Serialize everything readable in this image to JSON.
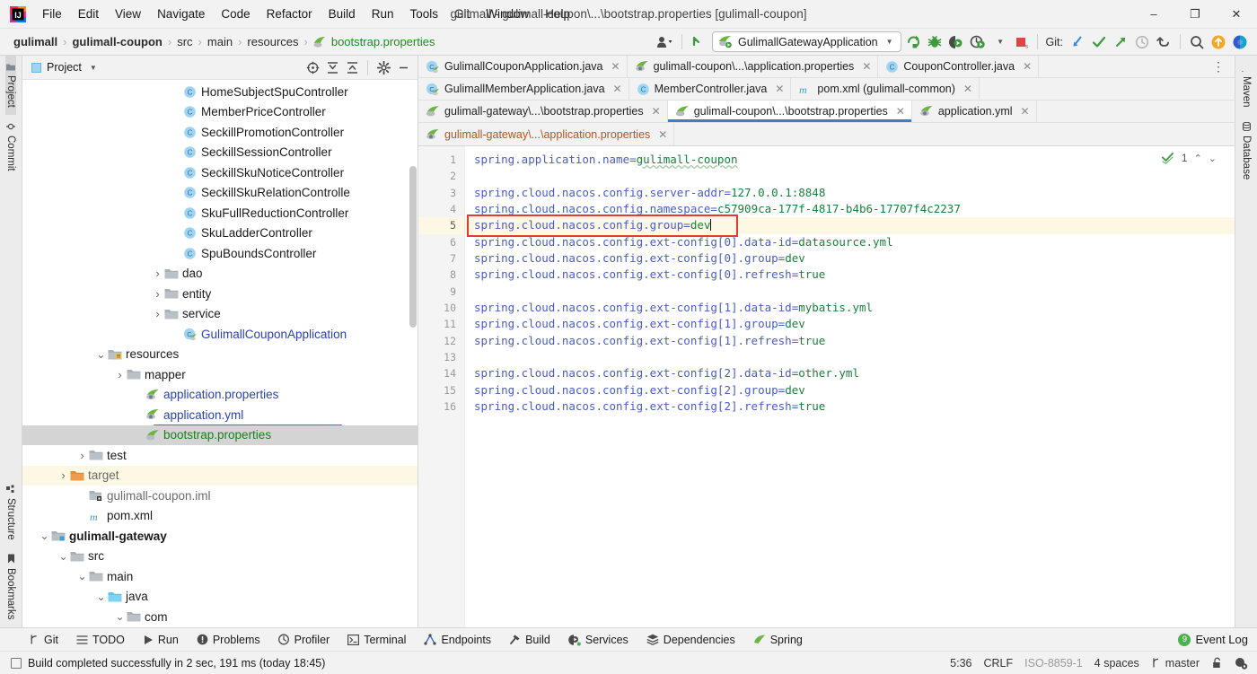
{
  "window": {
    "title": "gulimall - gulimall-coupon\\...\\bootstrap.properties [gulimall-coupon]",
    "minimize": "–",
    "maximize": "❐",
    "close": "✕"
  },
  "menubar": {
    "items": [
      "File",
      "Edit",
      "View",
      "Navigate",
      "Code",
      "Refactor",
      "Build",
      "Run",
      "Tools",
      "Git",
      "Window",
      "Help"
    ]
  },
  "navbar": {
    "crumbs": [
      {
        "label": "gulimall",
        "style": "bold"
      },
      {
        "label": "gulimall-coupon",
        "style": "bold"
      },
      {
        "label": "src",
        "style": "normal"
      },
      {
        "label": "main",
        "style": "normal"
      },
      {
        "label": "resources",
        "style": "normal"
      },
      {
        "label": "bootstrap.properties",
        "style": "file"
      }
    ],
    "separator": "›",
    "run_config": "GulimallGatewayApplication",
    "git_label": "Git:"
  },
  "left_rail": {
    "items": [
      "Project",
      "Commit",
      "Structure",
      "Bookmarks"
    ]
  },
  "right_rail": {
    "items": [
      "Maven",
      "Database"
    ]
  },
  "project_panel": {
    "title": "Project",
    "tree": [
      {
        "label": "HomeSubjectSpuController",
        "icon": "class-icon",
        "indent": 7,
        "arrow": "none",
        "color": "plain"
      },
      {
        "label": "MemberPriceController",
        "icon": "class-icon",
        "indent": 7,
        "arrow": "none",
        "color": "plain"
      },
      {
        "label": "SeckillPromotionController",
        "icon": "class-icon",
        "indent": 7,
        "arrow": "none",
        "color": "plain"
      },
      {
        "label": "SeckillSessionController",
        "icon": "class-icon",
        "indent": 7,
        "arrow": "none",
        "color": "plain"
      },
      {
        "label": "SeckillSkuNoticeController",
        "icon": "class-icon",
        "indent": 7,
        "arrow": "none",
        "color": "plain"
      },
      {
        "label": "SeckillSkuRelationControlle",
        "icon": "class-icon",
        "indent": 7,
        "arrow": "none",
        "color": "plain"
      },
      {
        "label": "SkuFullReductionController",
        "icon": "class-icon",
        "indent": 7,
        "arrow": "none",
        "color": "plain"
      },
      {
        "label": "SkuLadderController",
        "icon": "class-icon",
        "indent": 7,
        "arrow": "none",
        "color": "plain"
      },
      {
        "label": "SpuBoundsController",
        "icon": "class-icon",
        "indent": 7,
        "arrow": "none",
        "color": "plain"
      },
      {
        "label": "dao",
        "icon": "folder-icon",
        "indent": 6,
        "arrow": "collapsed",
        "color": "plain"
      },
      {
        "label": "entity",
        "icon": "folder-icon",
        "indent": 6,
        "arrow": "collapsed",
        "color": "plain"
      },
      {
        "label": "service",
        "icon": "folder-icon",
        "indent": 6,
        "arrow": "collapsed",
        "color": "plain"
      },
      {
        "label": "GulimallCouponApplication",
        "icon": "spring-class-icon",
        "indent": 7,
        "arrow": "none",
        "color": "blue"
      },
      {
        "label": "resources",
        "icon": "resources-folder-icon",
        "indent": 3,
        "arrow": "expanded",
        "color": "plain"
      },
      {
        "label": "mapper",
        "icon": "folder-icon",
        "indent": 4,
        "arrow": "collapsed",
        "color": "plain"
      },
      {
        "label": "application.properties",
        "icon": "spring-properties-icon",
        "indent": 5,
        "arrow": "none",
        "color": "blue"
      },
      {
        "label": "application.yml",
        "icon": "spring-properties-icon",
        "indent": 5,
        "arrow": "none",
        "color": "blue"
      },
      {
        "label": "bootstrap.properties",
        "icon": "spring-bootstrap-icon",
        "indent": 5,
        "arrow": "none",
        "color": "green",
        "selected": true,
        "highlighted": true
      },
      {
        "label": "test",
        "icon": "folder-icon",
        "indent": 2,
        "arrow": "collapsed",
        "color": "plain"
      },
      {
        "label": "target",
        "icon": "target-folder-icon",
        "indent": 1,
        "arrow": "collapsed",
        "color": "gray",
        "rowhl": true
      },
      {
        "label": "gulimall-coupon.iml",
        "icon": "iml-icon",
        "indent": 2,
        "arrow": "none",
        "color": "gray"
      },
      {
        "label": "pom.xml",
        "icon": "maven-icon",
        "indent": 2,
        "arrow": "none",
        "color": "plain"
      },
      {
        "label": "gulimall-gateway",
        "icon": "module-icon",
        "indent": 0,
        "arrow": "expanded",
        "color": "bold"
      },
      {
        "label": "src",
        "icon": "folder-icon",
        "indent": 1,
        "arrow": "expanded",
        "color": "plain"
      },
      {
        "label": "main",
        "icon": "folder-icon",
        "indent": 2,
        "arrow": "expanded",
        "color": "plain"
      },
      {
        "label": "java",
        "icon": "source-folder-icon",
        "indent": 3,
        "arrow": "expanded",
        "color": "plain"
      },
      {
        "label": "com",
        "icon": "folder-icon",
        "indent": 4,
        "arrow": "expanded",
        "color": "plain"
      }
    ]
  },
  "editor": {
    "tab_rows": [
      [
        {
          "label": "GulimallCouponApplication.java",
          "icon": "spring-class-icon",
          "active": false,
          "color": "plain"
        },
        {
          "label": "gulimall-coupon\\...\\application.properties",
          "icon": "spring-properties-icon",
          "active": false,
          "color": "plain"
        },
        {
          "label": "CouponController.java",
          "icon": "class-icon",
          "active": false,
          "color": "plain"
        }
      ],
      [
        {
          "label": "GulimallMemberApplication.java",
          "icon": "spring-class-icon",
          "active": false,
          "color": "plain"
        },
        {
          "label": "MemberController.java",
          "icon": "class-icon",
          "active": false,
          "color": "plain"
        },
        {
          "label": "pom.xml (gulimall-common)",
          "icon": "maven-icon",
          "active": false,
          "color": "plain"
        }
      ],
      [
        {
          "label": "gulimall-gateway\\...\\bootstrap.properties",
          "icon": "spring-bootstrap-icon",
          "active": false,
          "color": "plain"
        },
        {
          "label": "gulimall-coupon\\...\\bootstrap.properties",
          "icon": "spring-bootstrap-icon",
          "active": true,
          "color": "plain"
        },
        {
          "label": "application.yml",
          "icon": "spring-properties-icon",
          "active": false,
          "color": "plain"
        }
      ],
      [
        {
          "label": "gulimall-gateway\\...\\application.properties",
          "icon": "spring-properties-icon",
          "active": false,
          "color": "orange"
        }
      ]
    ],
    "close_glyph": "✕",
    "inspection_count": "1",
    "lines": [
      {
        "n": "1",
        "segs": [
          {
            "t": "spring.application.name=",
            "c": "k"
          },
          {
            "t": "gulimall-coupon",
            "c": "vu"
          }
        ]
      },
      {
        "n": "2",
        "segs": []
      },
      {
        "n": "3",
        "segs": [
          {
            "t": "spring.cloud.nacos.config.server-addr=",
            "c": "k"
          },
          {
            "t": "127.0.0.1:8848",
            "c": "v"
          }
        ]
      },
      {
        "n": "4",
        "segs": [
          {
            "t": "spring.cloud.nacos.config.namespace=",
            "c": "k"
          },
          {
            "t": "c57909ca-177f-4817-b4b6-17707f4c2237",
            "c": "v"
          }
        ]
      },
      {
        "n": "5",
        "segs": [
          {
            "t": "spring.cloud.nacos.config.group=",
            "c": "k"
          },
          {
            "t": "dev",
            "c": "v"
          }
        ],
        "current": true,
        "caret": true
      },
      {
        "n": "6",
        "segs": [
          {
            "t": "spring.cloud.nacos.config.ext-config[0].data-id=",
            "c": "k"
          },
          {
            "t": "datasource.yml",
            "c": "v"
          }
        ]
      },
      {
        "n": "7",
        "segs": [
          {
            "t": "spring.cloud.nacos.config.ext-config[0].group=",
            "c": "k"
          },
          {
            "t": "dev",
            "c": "v"
          }
        ]
      },
      {
        "n": "8",
        "segs": [
          {
            "t": "spring.cloud.nacos.config.ext-config[0].refresh=",
            "c": "k"
          },
          {
            "t": "true",
            "c": "v"
          }
        ]
      },
      {
        "n": "9",
        "segs": []
      },
      {
        "n": "10",
        "segs": [
          {
            "t": "spring.cloud.nacos.config.ext-config[1].data-id=",
            "c": "k"
          },
          {
            "t": "mybatis.yml",
            "c": "v"
          }
        ]
      },
      {
        "n": "11",
        "segs": [
          {
            "t": "spring.cloud.nacos.config.ext-config[1].group=",
            "c": "k"
          },
          {
            "t": "dev",
            "c": "v"
          }
        ]
      },
      {
        "n": "12",
        "segs": [
          {
            "t": "spring.cloud.nacos.config.ext-config[1].refresh=",
            "c": "k"
          },
          {
            "t": "true",
            "c": "v"
          }
        ]
      },
      {
        "n": "13",
        "segs": []
      },
      {
        "n": "14",
        "segs": [
          {
            "t": "spring.cloud.nacos.config.ext-config[2].data-id=",
            "c": "k"
          },
          {
            "t": "other.yml",
            "c": "v"
          }
        ]
      },
      {
        "n": "15",
        "segs": [
          {
            "t": "spring.cloud.nacos.config.ext-config[2].group=",
            "c": "k"
          },
          {
            "t": "dev",
            "c": "v"
          }
        ]
      },
      {
        "n": "16",
        "segs": [
          {
            "t": "spring.cloud.nacos.config.ext-config[2].refresh=",
            "c": "k"
          },
          {
            "t": "true",
            "c": "v"
          }
        ]
      }
    ]
  },
  "bottom_bar": {
    "items": [
      {
        "label": "Git",
        "icon": "git-branch-icon"
      },
      {
        "label": "TODO",
        "icon": "todo-list-icon"
      },
      {
        "label": "Run",
        "icon": "run-play-icon"
      },
      {
        "label": "Problems",
        "icon": "problems-icon"
      },
      {
        "label": "Profiler",
        "icon": "profiler-icon"
      },
      {
        "label": "Terminal",
        "icon": "terminal-icon"
      },
      {
        "label": "Endpoints",
        "icon": "endpoints-icon"
      },
      {
        "label": "Build",
        "icon": "build-hammer-icon"
      },
      {
        "label": "Services",
        "icon": "services-icon"
      },
      {
        "label": "Dependencies",
        "icon": "dependencies-icon"
      },
      {
        "label": "Spring",
        "icon": "spring-leaf-icon"
      }
    ],
    "event_log": "Event Log",
    "event_count": "9"
  },
  "status_bar": {
    "message": "Build completed successfully in 2 sec, 191 ms (today 18:45)",
    "caret_position": "5:36",
    "line_separator": "CRLF",
    "encoding": "ISO-8859-1",
    "indent": "4 spaces",
    "branch": "master"
  },
  "colors": {
    "accent_blue": "#3d7ec9",
    "highlight_red": "#e53935",
    "string_green": "#1a7f3c",
    "key_blue": "#4a5cc4",
    "current_line": "#fdf8e3",
    "selection_gray": "#d4d4d4"
  }
}
